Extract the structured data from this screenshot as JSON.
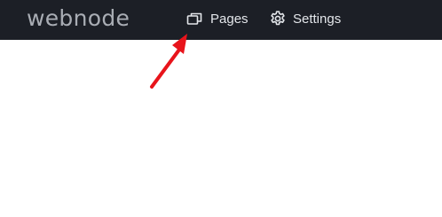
{
  "header": {
    "logo": "webnode",
    "nav": [
      {
        "label": "Pages",
        "icon": "pages-icon"
      },
      {
        "label": "Settings",
        "icon": "gear-icon"
      }
    ]
  },
  "annotation": {
    "arrow_color": "#e8141b",
    "icon": "red-arrow-icon"
  },
  "colors": {
    "topbar": "#1c1f26",
    "logo": "#a9adb4",
    "nav_text": "#e3e6ea",
    "background": "#ffffff"
  }
}
